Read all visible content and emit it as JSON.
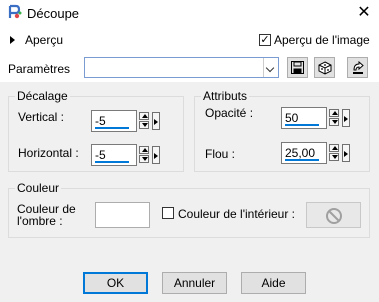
{
  "window": {
    "title": "Découpe",
    "close_glyph": "✕"
  },
  "preview": {
    "label": "Aperçu",
    "image_preview_label": "Aperçu de l'image",
    "image_preview_checked": true
  },
  "params": {
    "label": "Paramètres",
    "preset_value": ""
  },
  "toolbar_icons": [
    "save-icon",
    "random-dice-icon",
    "reset-icon"
  ],
  "offset": {
    "title": "Décalage",
    "vertical_label": "Vertical :",
    "vertical_value": "-5",
    "horizontal_label": "Horizontal :",
    "horizontal_value": "-5"
  },
  "attributes": {
    "title": "Attributs",
    "opacity_label": "Opacité :",
    "opacity_value": "50",
    "blur_label": "Flou :",
    "blur_value": "25,00"
  },
  "color": {
    "title": "Couleur",
    "shadow_label_line1": "Couleur de",
    "shadow_label_line2": "l'ombre :",
    "shadow_color": "#ffffff",
    "interior_label": "Couleur de l'intérieur :",
    "interior_checked": false
  },
  "buttons": {
    "ok": "OK",
    "cancel": "Annuler",
    "help": "Aide"
  },
  "colors": {
    "accent": "#0078d7",
    "button_bg": "#e1e1e1",
    "panel_bg": "#f0f0f0"
  }
}
